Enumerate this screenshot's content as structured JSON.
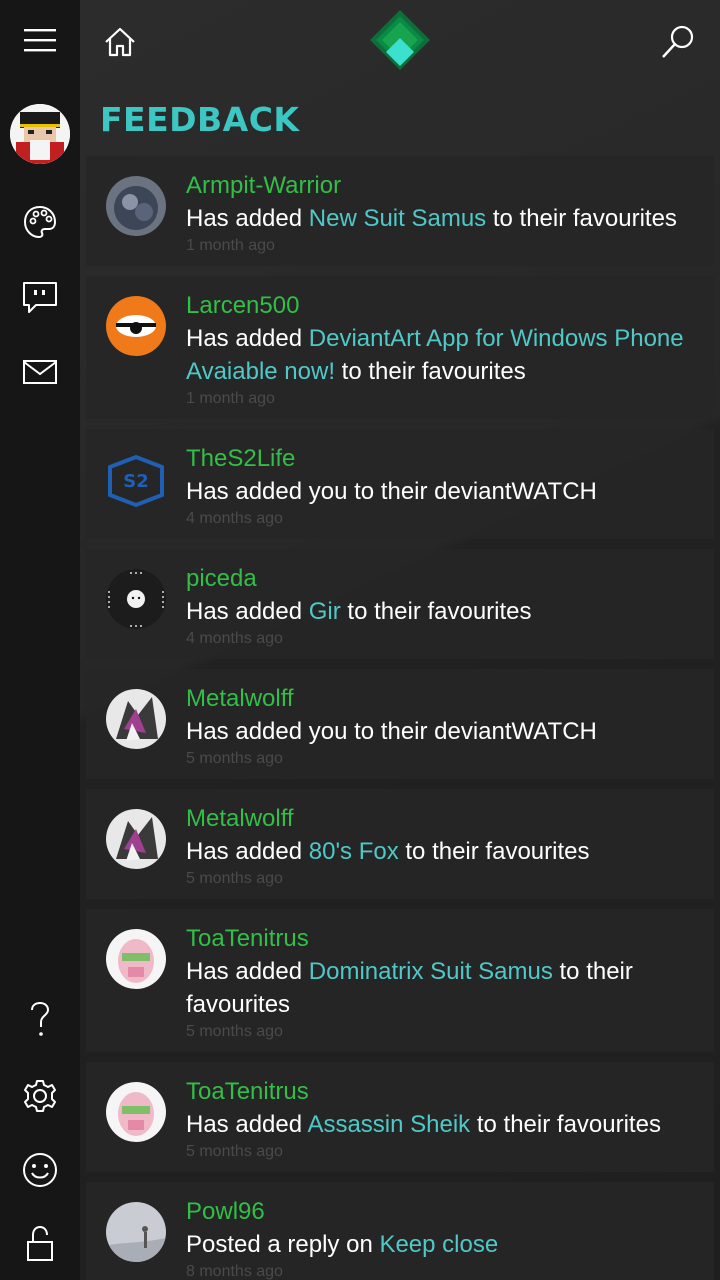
{
  "header": {
    "title": "FEEDBACK"
  },
  "colors": {
    "accent": "#3cc7c3",
    "username": "#31bf47",
    "link": "#4fc9c7",
    "rail_bg": "#161616"
  },
  "rail": {
    "icons": [
      "menu-icon",
      "avatar",
      "palette-icon",
      "comment-icon",
      "mail-icon",
      "help-icon",
      "settings-icon",
      "smiley-icon",
      "lock-icon"
    ]
  },
  "feed": [
    {
      "user": "Armpit-Warrior",
      "pre": "Has added ",
      "link": "New Suit Samus",
      "post": " to their favourites",
      "time": "1 month ago"
    },
    {
      "user": "Larcen500",
      "pre": "Has added ",
      "link": "DeviantArt App for Windows Phone Avaiable now!",
      "post": " to their favourites",
      "time": "1 month ago"
    },
    {
      "user": "TheS2Life",
      "pre": "Has added you to their deviantWATCH",
      "link": "",
      "post": "",
      "time": "4 months ago"
    },
    {
      "user": "piceda",
      "pre": "Has added ",
      "link": "Gir",
      "post": " to their favourites",
      "time": "4 months ago"
    },
    {
      "user": "Metalwolff",
      "pre": "Has added you to their deviantWATCH",
      "link": "",
      "post": "",
      "time": "5 months ago"
    },
    {
      "user": "Metalwolff",
      "pre": "Has added ",
      "link": "80's Fox",
      "post": " to their favourites",
      "time": "5 months ago"
    },
    {
      "user": "ToaTenitrus",
      "pre": "Has added ",
      "link": "Dominatrix Suit Samus",
      "post": " to their favourites",
      "time": "5 months ago"
    },
    {
      "user": "ToaTenitrus",
      "pre": "Has added ",
      "link": "Assassin Sheik",
      "post": " to their favourites",
      "time": "5 months ago"
    },
    {
      "user": "Powl96",
      "pre": "Posted a reply on ",
      "link": " Keep close",
      "post": "",
      "time": "8 months ago"
    }
  ]
}
